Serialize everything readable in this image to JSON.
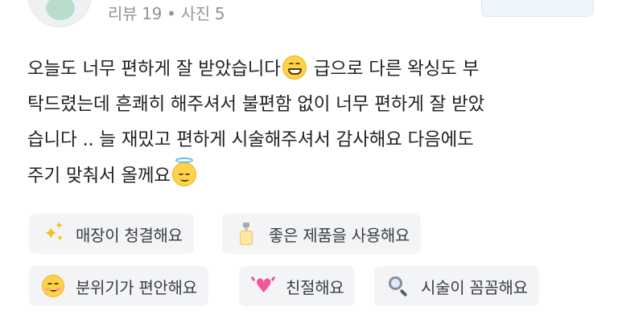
{
  "header": {
    "review_count": "리뷰 19",
    "separator": "•",
    "photo_count": "사진 5"
  },
  "review": {
    "lines": [
      "오늘도 너무 편하게 잘 받았습니다",
      "급으로 다른 왁싱도 부",
      "탁드렸는데 흔쾌히 해주셔서 불편함 없이 너무 편하게 잘 받았",
      "습니다 .. 늘 재밌고 편하게 시술해주셔서 감사해요 다음에도",
      "주기 맞춰서 올께요"
    ],
    "emojis": [
      "grinning-face-emoji",
      "smiling-face-with-halo-emoji"
    ]
  },
  "tags": [
    {
      "label": "매장이 청결해요",
      "icon": "sparkles-icon"
    },
    {
      "label": "좋은 제품을 사용해요",
      "icon": "lotion-bottle-icon"
    },
    {
      "label": "분위기가 편안해요",
      "icon": "smiling-face-icon"
    },
    {
      "label": "친절해요",
      "icon": "growing-heart-icon"
    },
    {
      "label": "시술이 꼼꼼해요",
      "icon": "magnifier-icon"
    }
  ],
  "colors": {
    "tag_background": "#f3f4f6",
    "meta_text": "#8f9499",
    "body_text": "#222222"
  }
}
